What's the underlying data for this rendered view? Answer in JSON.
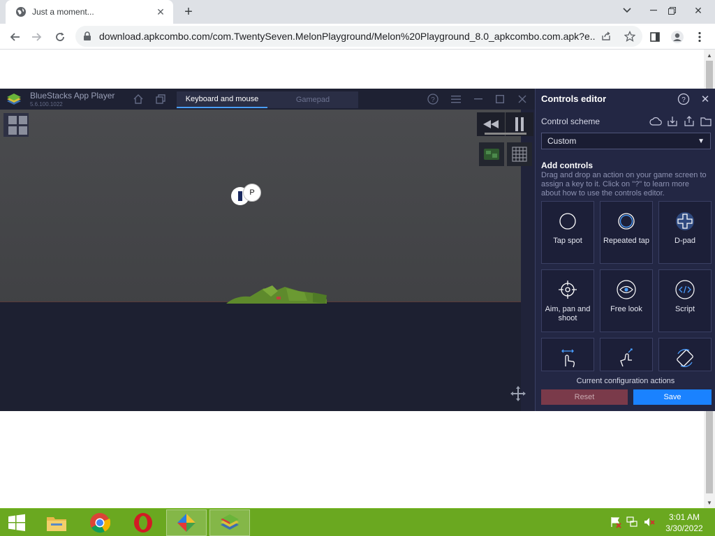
{
  "browser": {
    "tab_title": "Just a moment...",
    "url": "download.apkcombo.com/com.TwentySeven.MelonPlayground/Melon%20Playground_8.0_apkcombo.com.apk?e..."
  },
  "bluestacks": {
    "app_name": "BlueStacks App Player",
    "version": "5.6.100.1022",
    "tabs": [
      "Keyboard and mouse",
      "Gamepad"
    ],
    "active_tab": "Keyboard and mouse",
    "key_label": "P"
  },
  "controls_editor": {
    "title": "Controls editor",
    "scheme_label": "Control scheme",
    "scheme_value": "Custom",
    "add_title": "Add controls",
    "add_desc": "Drag and drop an action on your game screen to assign a key to it. Click on \"?\" to learn more about how to use the controls editor.",
    "tiles": [
      {
        "label": "Tap spot",
        "icon": "tap-spot-icon"
      },
      {
        "label": "Repeated tap",
        "icon": "repeated-tap-icon"
      },
      {
        "label": "D-pad",
        "icon": "dpad-icon"
      },
      {
        "label": "Aim, pan and shoot",
        "icon": "crosshair-icon"
      },
      {
        "label": "Free look",
        "icon": "eye-icon"
      },
      {
        "label": "Script",
        "icon": "code-icon"
      },
      {
        "label": "",
        "icon": "swipe-icon"
      },
      {
        "label": "",
        "icon": "zoom-gesture-icon"
      },
      {
        "label": "",
        "icon": "rotate-icon"
      }
    ],
    "footer_label": "Current configuration actions",
    "reset_label": "Reset",
    "save_label": "Save",
    "accent": "#1a82ff"
  },
  "taskbar": {
    "time": "3:01 AM",
    "date": "3/30/2022",
    "color": "#6aa820"
  }
}
